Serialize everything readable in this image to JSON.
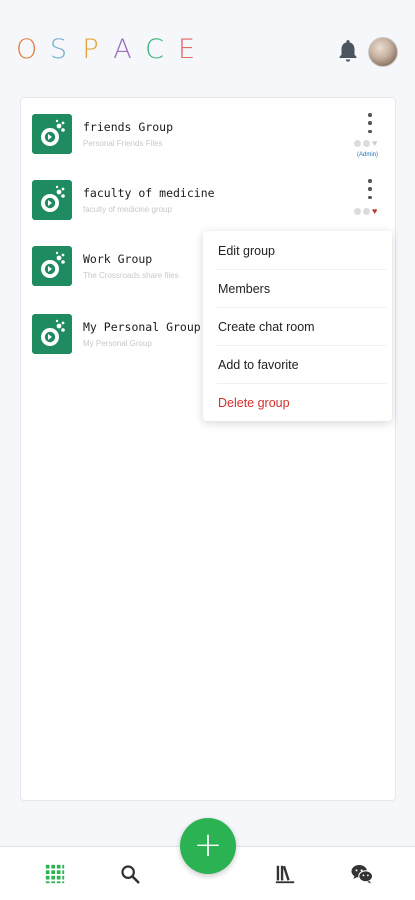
{
  "header": {
    "logo_letters": [
      {
        "char": "O",
        "color": "#e0824a"
      },
      {
        "char": "S",
        "color": "#6fb0d2"
      },
      {
        "char": "P",
        "color": "#e5a43a"
      },
      {
        "char": "A",
        "color": "#9a6fc0"
      },
      {
        "char": "C",
        "color": "#3bb37a"
      },
      {
        "char": "E",
        "color": "#e36a5e"
      }
    ],
    "notification_icon": "bell-icon",
    "avatar_icon": "user-avatar"
  },
  "groups": [
    {
      "name": "friends Group",
      "description": "Personal Friends Files",
      "status": [
        "dot",
        "dot",
        "heart"
      ],
      "heart_active": false,
      "badge": "(Admin)"
    },
    {
      "name": "faculty of medicine",
      "description": "faculty of medicine group",
      "status": [
        "dot",
        "dot",
        "heart"
      ],
      "heart_active": true,
      "badge": ""
    },
    {
      "name": "Work Group",
      "description": "The Crossroads share files",
      "status": [],
      "heart_active": false,
      "badge": ""
    },
    {
      "name": "My Personal Group",
      "description": "My Personal Group",
      "status": [],
      "heart_active": false,
      "badge": ""
    }
  ],
  "context_menu": {
    "items": [
      {
        "label": "Edit group",
        "danger": false
      },
      {
        "label": "Members",
        "danger": false
      },
      {
        "label": "Create chat room",
        "danger": false
      },
      {
        "label": "Add to favorite",
        "danger": false
      },
      {
        "label": "Delete group",
        "danger": true
      }
    ]
  },
  "bottom_nav": {
    "items": [
      {
        "icon": "grid-icon",
        "active": true,
        "color": "#2bb353"
      },
      {
        "icon": "search-icon",
        "active": false,
        "color": "#333333"
      },
      {
        "icon": "library-icon",
        "active": false,
        "color": "#333333"
      },
      {
        "icon": "wechat-icon",
        "active": false,
        "color": "#333333"
      }
    ],
    "fab_label": "+",
    "fab_color": "#2bb353"
  }
}
